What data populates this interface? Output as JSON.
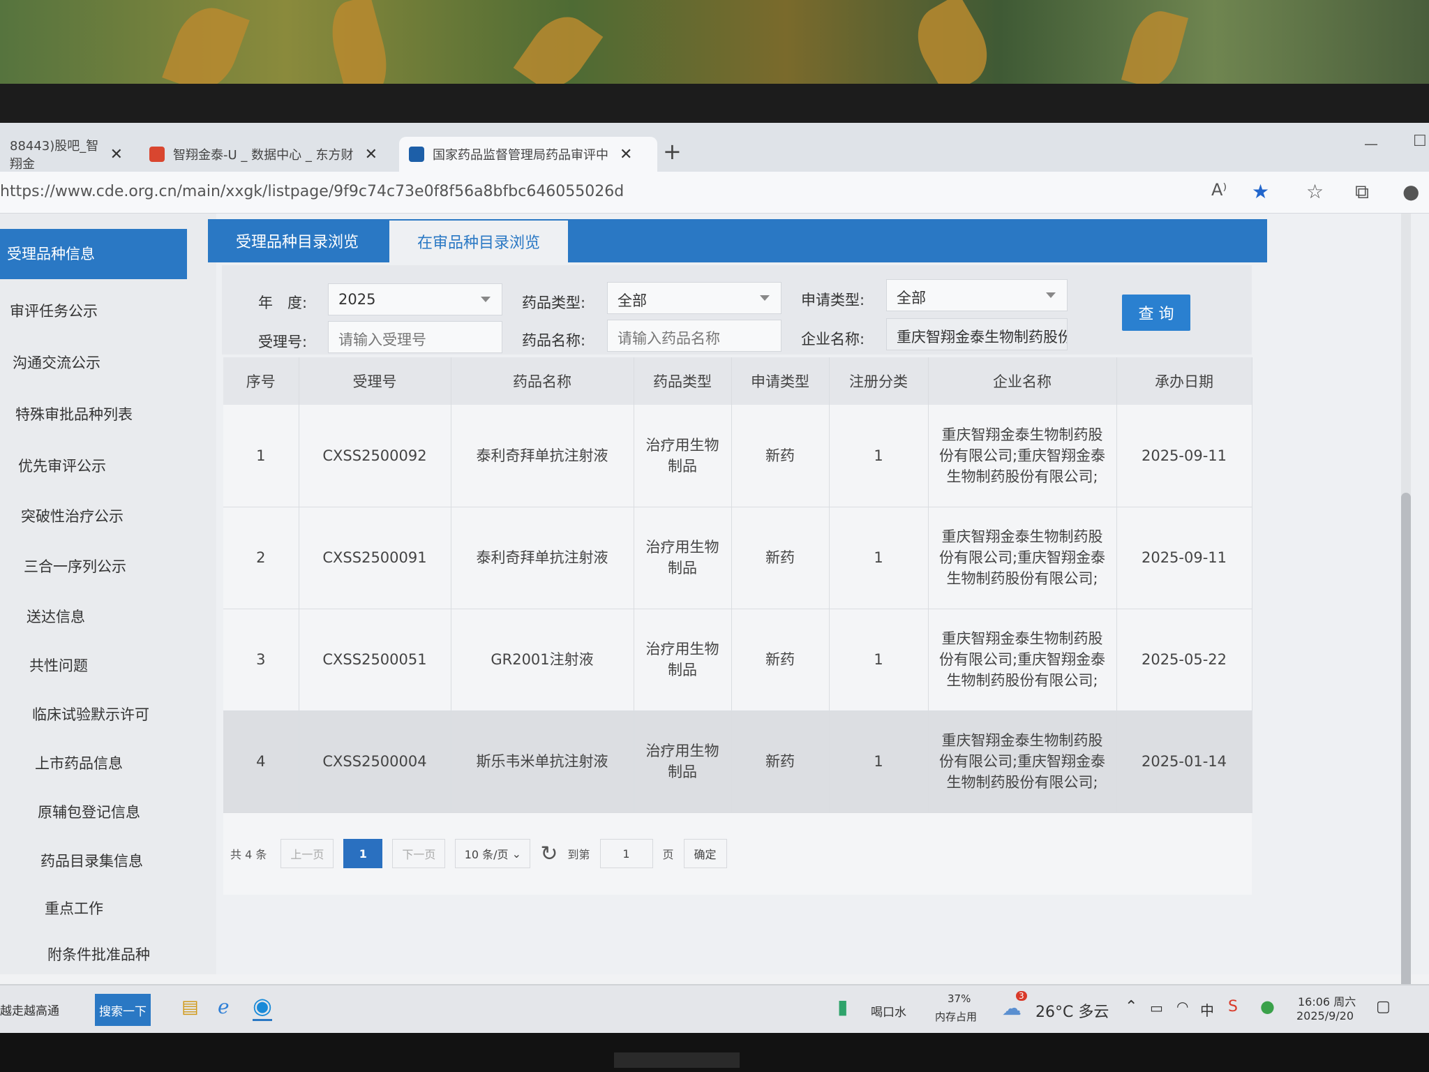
{
  "browser": {
    "tabs": [
      {
        "label": "88443)股吧_智翔金",
        "close": "✕",
        "icon": "stock-icon"
      },
      {
        "label": "智翔金泰-U _ 数据中心 _ 东方财",
        "close": "✕",
        "icon": "eastmoney-icon"
      },
      {
        "label": "国家药品监督管理局药品审评中",
        "close": "✕",
        "icon": "cde-icon"
      }
    ],
    "new_tab": "+",
    "url": "https://www.cde.org.cn/main/xxgk/listpage/9f9c74c73e0f8f56a8bfbc646055026d"
  },
  "sidebar": {
    "items": [
      "受理品种信息",
      "审评任务公示",
      "沟通交流公示",
      "特殊审批品种列表",
      "优先审评公示",
      "突破性治疗公示",
      "三合一序列公示",
      "送达信息",
      "共性问题",
      "临床试验默示许可",
      "上市药品信息",
      "原辅包登记信息",
      "药品目录集信息",
      "重点工作",
      "附条件批准品种"
    ]
  },
  "page_tabs": [
    "受理品种目录浏览",
    "在审品种目录浏览"
  ],
  "filters": {
    "year_label": "年　度:",
    "year_value": "2025",
    "drug_type_label": "药品类型:",
    "drug_type_value": "全部",
    "apply_type_label": "申请类型:",
    "apply_type_value": "全部",
    "accept_no_label": "受理号:",
    "accept_no_placeholder": "请输入受理号",
    "drug_name_label": "药品名称:",
    "drug_name_placeholder": "请输入药品名称",
    "company_label": "企业名称:",
    "company_value": "重庆智翔金泰生物制药股份",
    "query_button": "查 询"
  },
  "table": {
    "headers": [
      "序号",
      "受理号",
      "药品名称",
      "药品类型",
      "申请类型",
      "注册分类",
      "企业名称",
      "承办日期"
    ],
    "rows": [
      {
        "no": "1",
        "accept_no": "CXSS2500092",
        "name": "泰利奇拜单抗注射液",
        "type": "治疗用生物制品",
        "apply": "新药",
        "reg": "1",
        "company": "重庆智翔金泰生物制药股份有限公司;重庆智翔金泰生物制药股份有限公司;",
        "date": "2025-09-11"
      },
      {
        "no": "2",
        "accept_no": "CXSS2500091",
        "name": "泰利奇拜单抗注射液",
        "type": "治疗用生物制品",
        "apply": "新药",
        "reg": "1",
        "company": "重庆智翔金泰生物制药股份有限公司;重庆智翔金泰生物制药股份有限公司;",
        "date": "2025-09-11"
      },
      {
        "no": "3",
        "accept_no": "CXSS2500051",
        "name": "GR2001注射液",
        "type": "治疗用生物制品",
        "apply": "新药",
        "reg": "1",
        "company": "重庆智翔金泰生物制药股份有限公司;重庆智翔金泰生物制药股份有限公司;",
        "date": "2025-05-22"
      },
      {
        "no": "4",
        "accept_no": "CXSS2500004",
        "name": "斯乐韦米单抗注射液",
        "type": "治疗用生物制品",
        "apply": "新药",
        "reg": "1",
        "company": "重庆智翔金泰生物制药股份有限公司;重庆智翔金泰生物制药股份有限公司;",
        "date": "2025-01-14"
      }
    ]
  },
  "pager": {
    "total": "共 4 条",
    "prev": "上一页",
    "current": "1",
    "next": "下一页",
    "page_size": "10 条/页",
    "goto_label": "到第",
    "goto_value": "1",
    "page_unit": "页",
    "confirm": "确定"
  },
  "taskbar": {
    "left_text": "越走越高通",
    "search_button": "搜索一下",
    "water_label": "喝口水",
    "memory_value": "37%",
    "memory_label": "内存占用",
    "weather_badge": "3",
    "weather": "26°C 多云",
    "ime": "中",
    "time": "16:06 周六",
    "date": "2025/9/20"
  },
  "colors": {
    "accent": "#2a78c4",
    "query_button": "#2a80d0"
  }
}
